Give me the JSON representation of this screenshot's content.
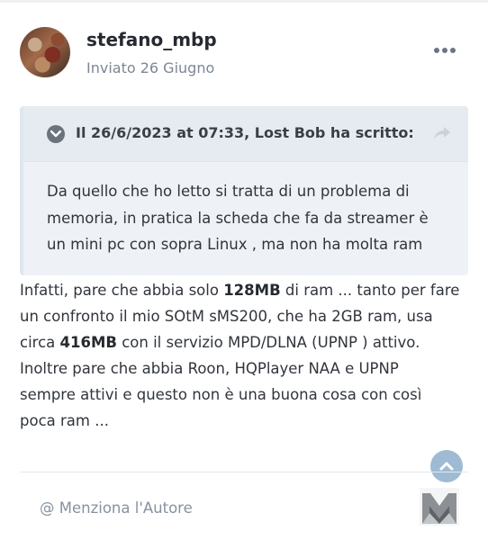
{
  "post": {
    "author": "stefano_mbp",
    "meta": "Inviato 26 Giugno"
  },
  "quote": {
    "cite": "Il 26/6/2023 at 07:33, Lost Bob ha scritto:",
    "lines": [
      "Da quello che ho letto si tratta di un problema di",
      "memoria, in pratica la scheda che fa da streamer è",
      "un mini pc con sopra Linux , ma non ha molta ram"
    ]
  },
  "body": {
    "l1_before": "Infatti, pare che abbia solo ",
    "l1_bold": "128MB",
    "l1_after": " di ram ... tanto per fare",
    "l2": "un confronto il mio SOtM sMS200, che ha 2GB ram, usa",
    "l3_before": "circa ",
    "l3_bold": "416MB",
    "l3_after": " con il servizio MPD/DLNA (UPNP ) attivo.",
    "l4": "Inoltre pare che abbia Roon, HQPlayer NAA e UPNP",
    "l5": "sempre attivi e questo non è una buona cosa con così",
    "l6": "poca ram ..."
  },
  "footer": {
    "mention": "@ Menziona l'Autore"
  },
  "icons": {
    "more": "more-horizontal-icon",
    "toggle": "chevron-down-circle-icon",
    "share": "share-arrow-icon",
    "scroll_top": "chevron-up-icon",
    "logo": "site-logo-icon"
  },
  "colors": {
    "accent": "#9fbbd4",
    "quote_bg": "#eef2f6",
    "muted_text": "#7d8793"
  }
}
